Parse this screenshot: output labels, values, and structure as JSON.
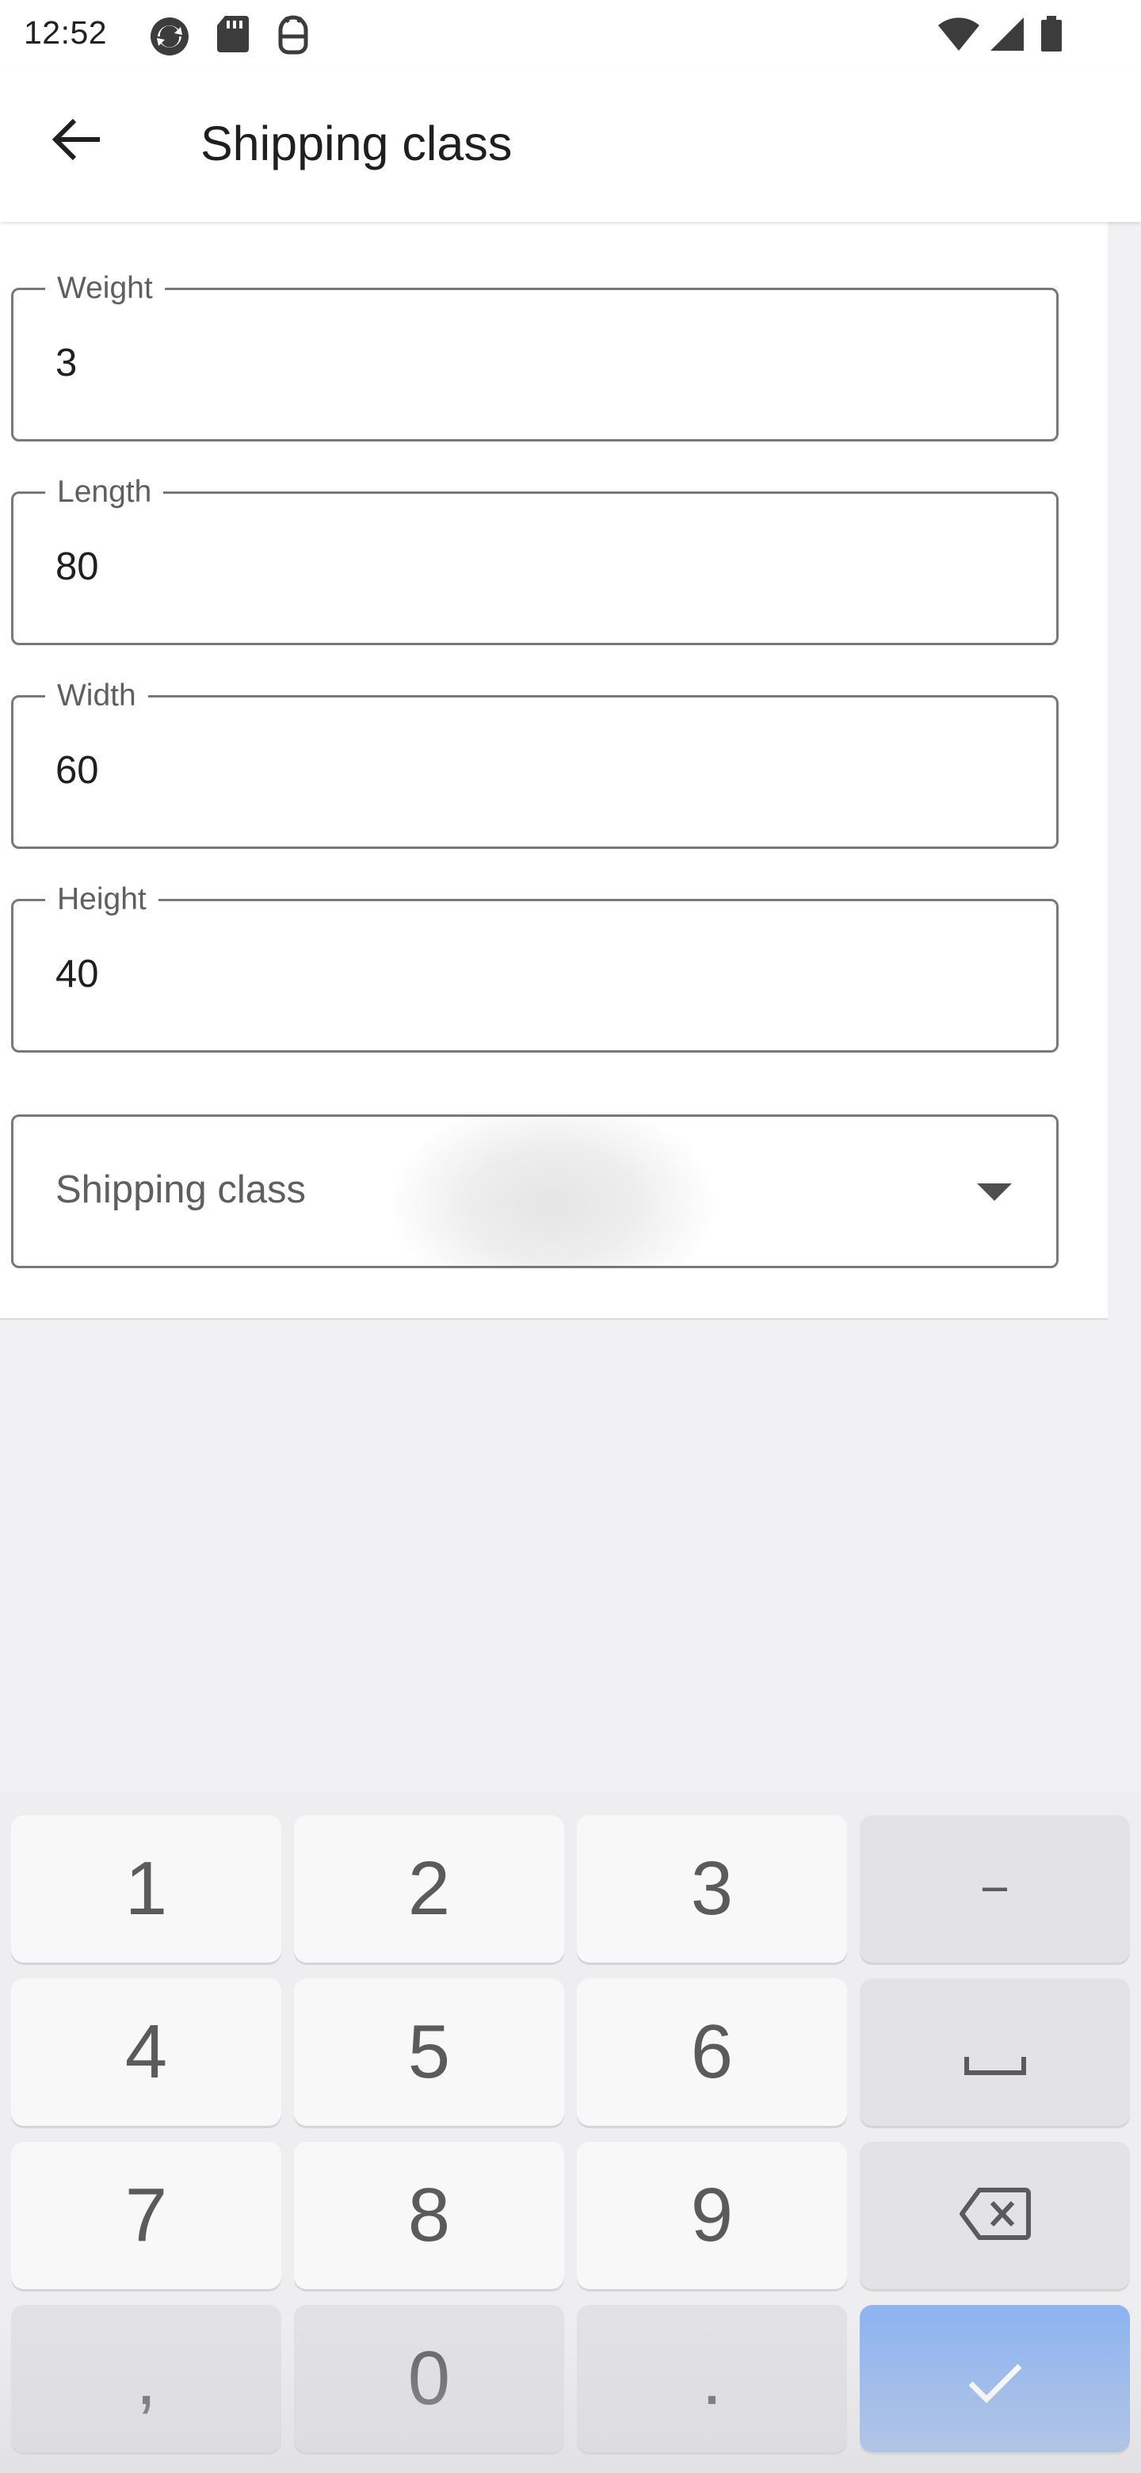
{
  "status_bar": {
    "time": "12:52",
    "left_icons": [
      "sync-icon",
      "sd-card-icon",
      "android-debug-icon"
    ],
    "right_icons": [
      "wifi-icon",
      "cellular-signal-icon",
      "battery-icon"
    ]
  },
  "app_bar": {
    "title": "Shipping class",
    "back_icon": "arrow-back-icon"
  },
  "form": {
    "weight": {
      "label": "Weight",
      "value": "3"
    },
    "length": {
      "label": "Length",
      "value": "80"
    },
    "width": {
      "label": "Width",
      "value": "60"
    },
    "height": {
      "label": "Height",
      "value": "40"
    },
    "shipping_class": {
      "placeholder": "Shipping class",
      "icon": "dropdown-arrow-icon"
    }
  },
  "keyboard": {
    "row1": [
      "1",
      "2",
      "3",
      "−"
    ],
    "row2": [
      "4",
      "5",
      "6",
      "space-icon"
    ],
    "row3": [
      "7",
      "8",
      "9",
      "backspace-icon"
    ],
    "row4": [
      ",",
      "0",
      ".",
      "done-check-icon"
    ]
  },
  "colors": {
    "surface": "#ffffff",
    "background": "#f1f1f3",
    "outline": "#787878",
    "keyboard_background": "#eeeef0",
    "key": "#f8f8f8",
    "function_key": "#e3e3e6",
    "action_key": "#8fb4ef"
  }
}
